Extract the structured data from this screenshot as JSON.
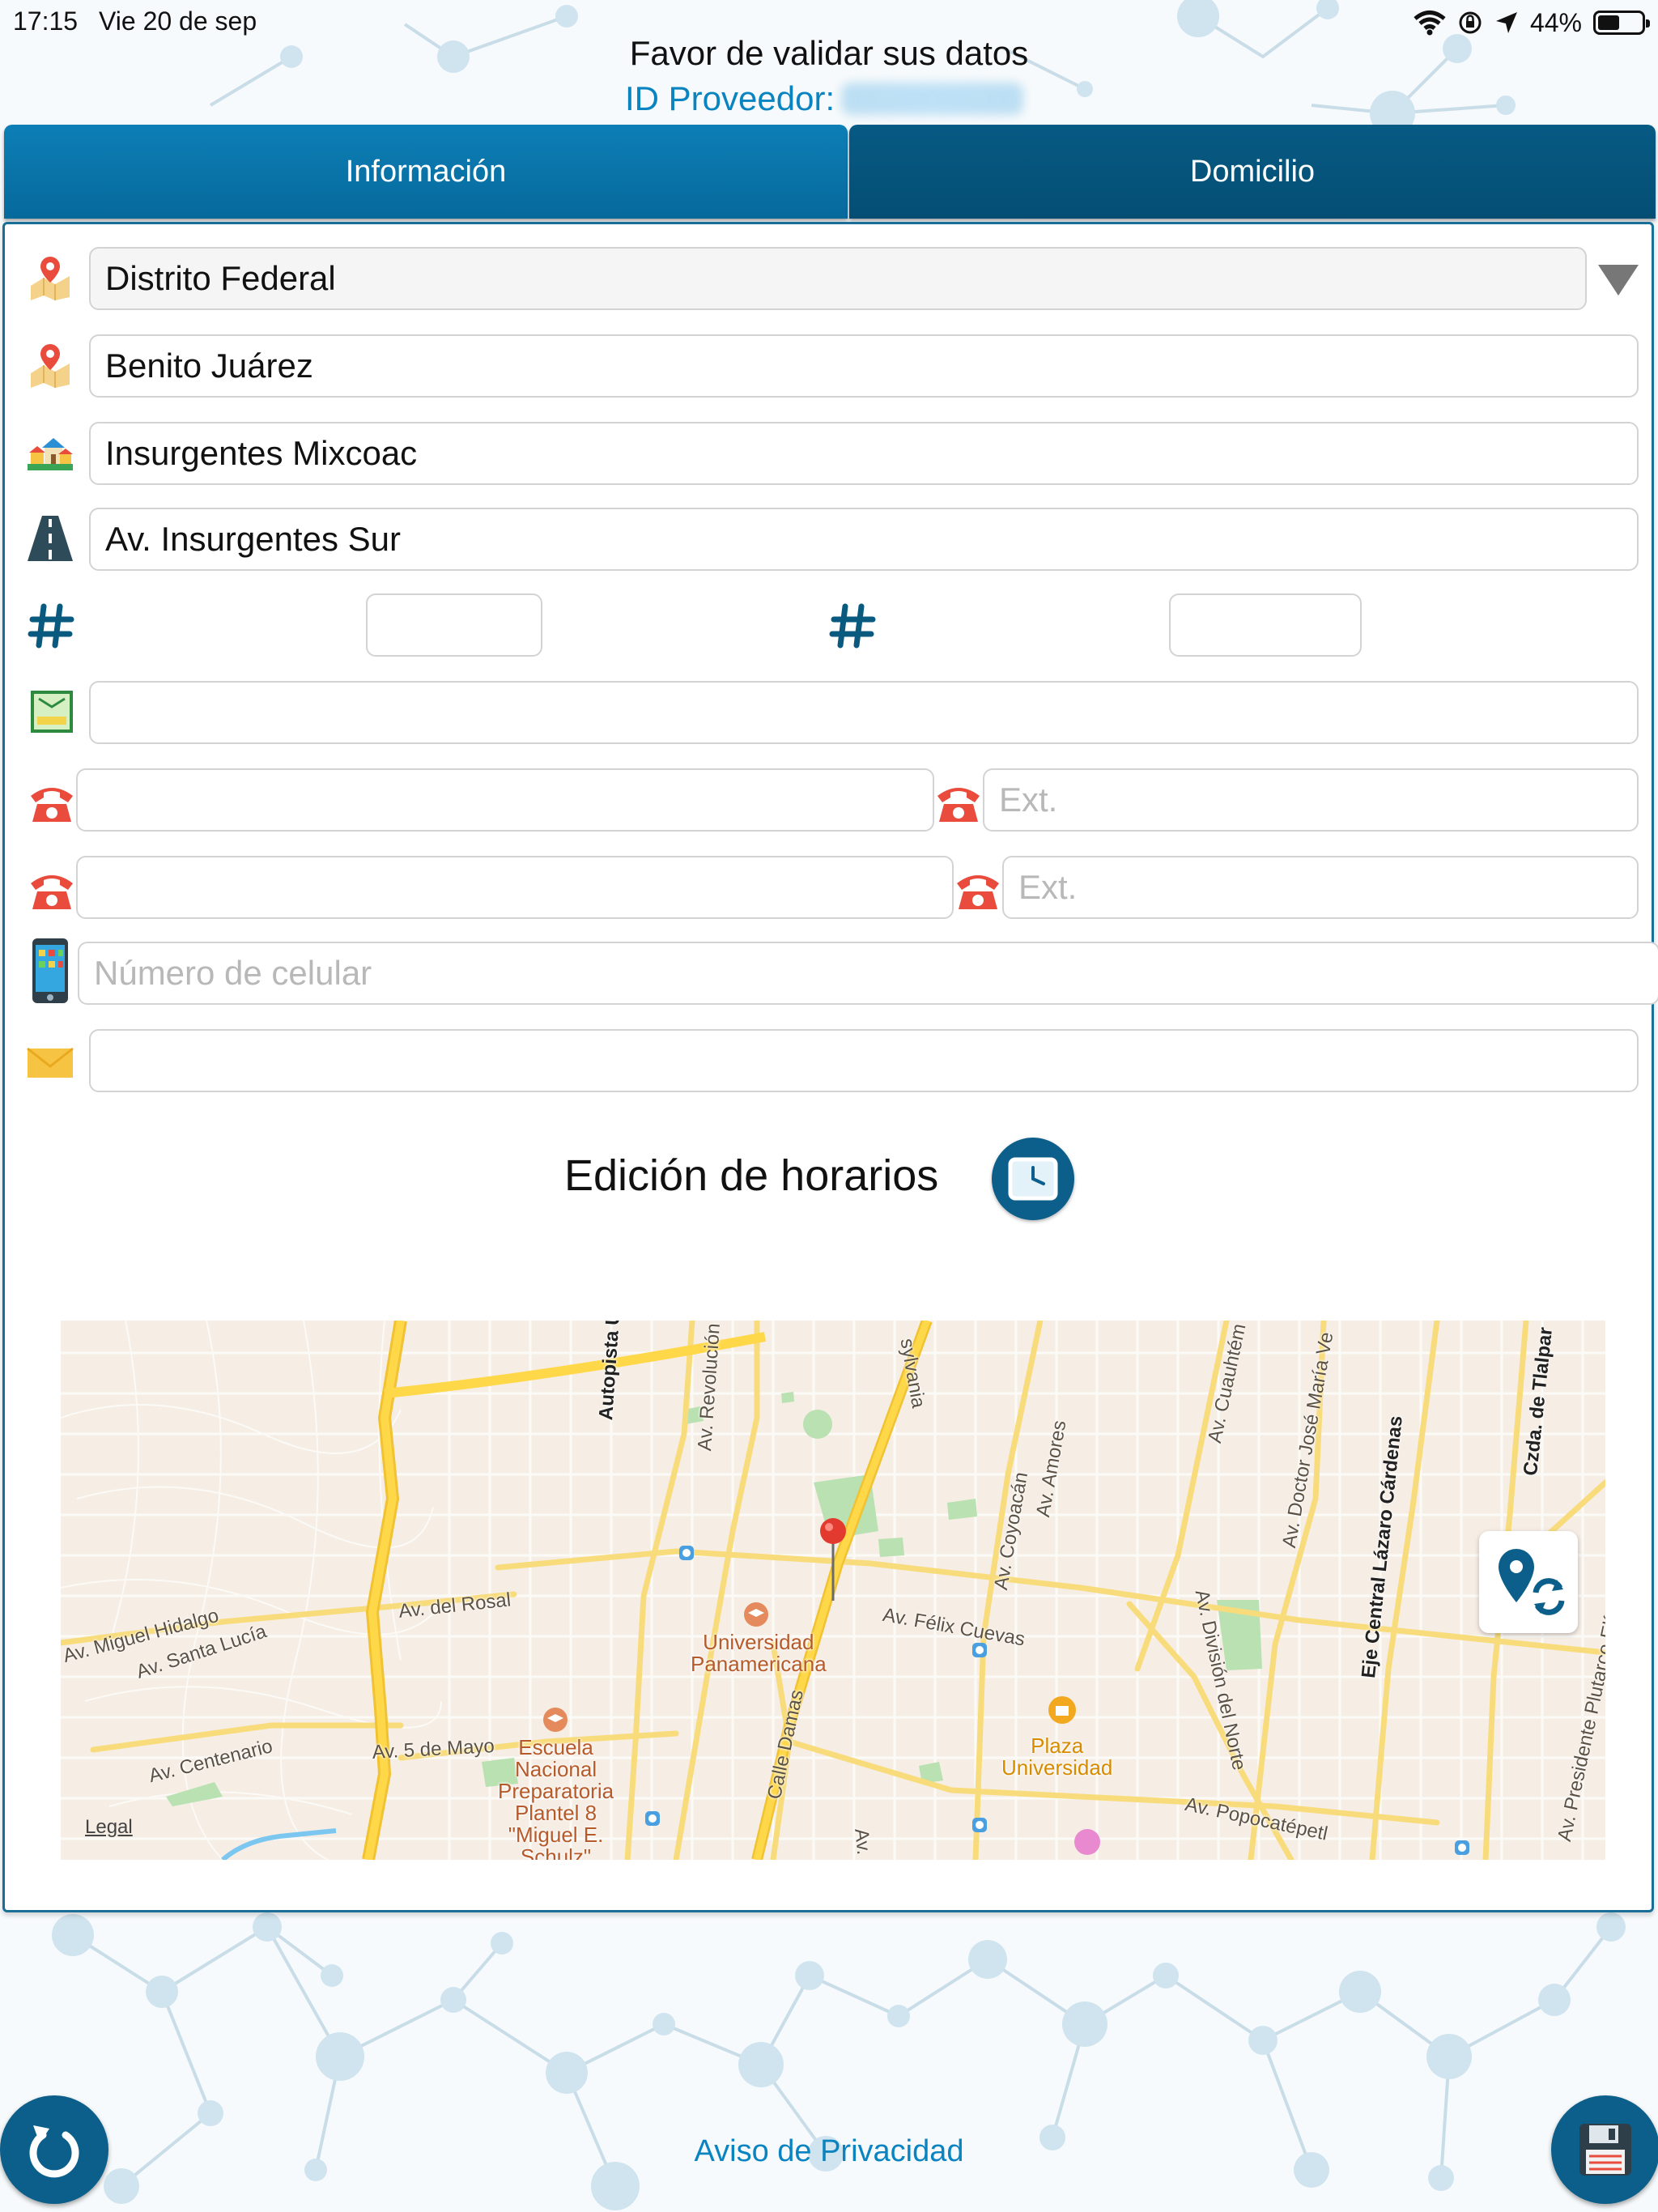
{
  "status_bar": {
    "time": "17:15",
    "date": "Vie 20 de sep",
    "battery": "44%"
  },
  "header": {
    "title": "Favor de validar sus datos",
    "id_label": "ID Proveedor:"
  },
  "tabs": [
    {
      "label": "Información"
    },
    {
      "label": "Domicilio"
    }
  ],
  "form": {
    "estado": "Distrito Federal",
    "municipio": "Benito Juárez",
    "colonia": "Insurgentes Mixcoac",
    "calle": "Av. Insurgentes Sur",
    "numero_exterior": "",
    "numero_interior": "",
    "codigo_postal": "",
    "telefono_1": "",
    "ext_1_placeholder": "Ext.",
    "telefono_2": "",
    "ext_2_placeholder": "Ext.",
    "celular_placeholder": "Número de celular",
    "email": ""
  },
  "hours": {
    "label": "Edición de horarios"
  },
  "map": {
    "labels": {
      "autopista": "Autopista Urbana Nori",
      "revolucion": "Av. Revolución",
      "pennsylvania": "sylvania",
      "coyoacan": "Av. Coyoacán",
      "amores": "Av. Amores",
      "cuauhtemoc": "Av. Cuauhtém",
      "doctor_jose": "Av. Doctor José María Ve",
      "lazaro": "Eje Central Lázaro Cárdenas",
      "tlalpan": "Czda. de Tlalpar",
      "miguel_hidalgo": "Av. Miguel Hidalgo",
      "santa_lucia": "Av. Santa Lucía",
      "del_rosal": "Av. del Rosal",
      "felix_cuevas": "Av. Félix Cuevas",
      "division_norte": "Av. División del Norte",
      "plutarco": "Av. Presidente Plutarco Elías Calles",
      "centenario": "Av. Centenario",
      "cinco_mayo": "Av. 5 de Mayo",
      "calle_damas": "Calle Damas",
      "av_small": "Av.",
      "popocatepetl": "Av. Popocatépetl",
      "universidad_1": "Universidad",
      "universidad_2": "Panamericana",
      "escuela_1": "Escuela",
      "escuela_2": "Nacional",
      "escuela_3": "Preparatoria",
      "escuela_4": "Plantel 8",
      "escuela_5": "\"Miguel E.",
      "escuela_6": "Schulz\"",
      "plaza_1": "Plaza",
      "plaza_2": "Universidad",
      "legal": "Legal"
    }
  },
  "footer": {
    "privacy": "Aviso de Privacidad"
  },
  "colors": {
    "primary": "#0a84c0",
    "tab_active": "#06699c",
    "tab_inactive": "#044e74",
    "fab": "#0c5f8a"
  }
}
